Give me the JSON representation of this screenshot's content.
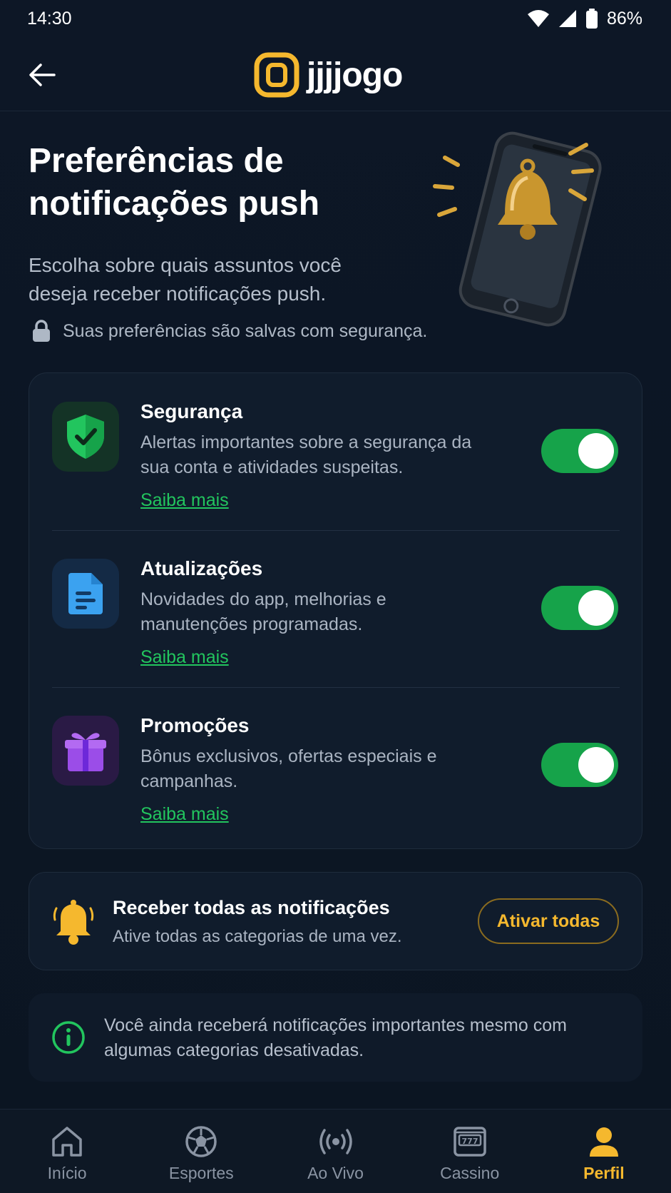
{
  "status_bar": {
    "time": "14:30",
    "battery": "86%"
  },
  "header": {
    "logo_text": "jjjjogo"
  },
  "hero": {
    "title": "Preferências de notificações push",
    "subtitle": "Escolha sobre quais assuntos você deseja receber notificações push.",
    "security_note": "Suas preferências são salvas com segurança."
  },
  "categories": [
    {
      "title": "Segurança",
      "description": "Alertas importantes sobre a segurança da sua conta e atividades suspeitas.",
      "link": "Saiba mais",
      "enabled": true
    },
    {
      "title": "Atualizações",
      "description": "Novidades do app, melhorias e manutenções programadas.",
      "link": "Saiba mais",
      "enabled": true
    },
    {
      "title": "Promoções",
      "description": "Bônus exclusivos, ofertas especiais e campanhas.",
      "link": "Saiba mais",
      "enabled": true
    }
  ],
  "receive_all": {
    "title": "Receber todas as notificações",
    "description": "Ative todas as categorias de uma vez.",
    "button": "Ativar todas"
  },
  "info": {
    "text": "Você ainda receberá notificações importantes mesmo com algumas categorias desativadas."
  },
  "nav": {
    "items": [
      {
        "label": "Início",
        "icon": "home-icon"
      },
      {
        "label": "Esportes",
        "icon": "soccer-ball-icon"
      },
      {
        "label": "Ao Vivo",
        "icon": "live-broadcast-icon"
      },
      {
        "label": "Cassino",
        "icon": "slot-machine-icon"
      },
      {
        "label": "Perfil",
        "icon": "user-icon"
      }
    ],
    "active": "Perfil"
  },
  "colors": {
    "accent": "#f5b82e",
    "toggle_on": "#16a34a",
    "link": "#22c55e",
    "background": "#0c1624",
    "card": "#101c2c"
  }
}
